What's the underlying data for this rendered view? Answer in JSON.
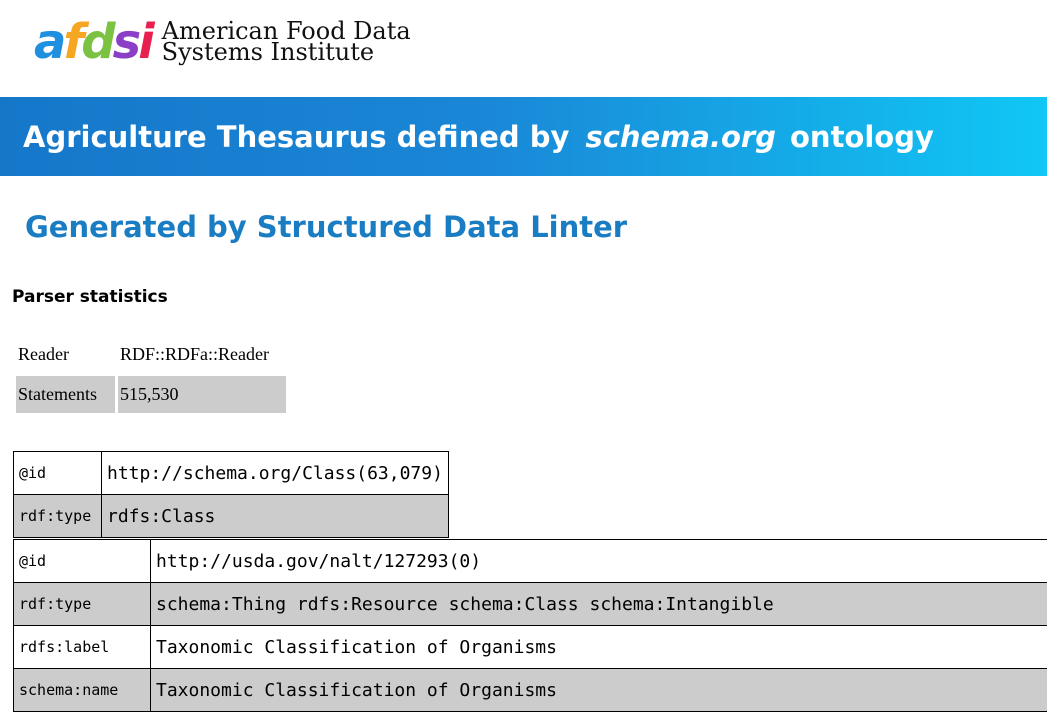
{
  "logo": {
    "letters": [
      {
        "ch": "a",
        "color": "#1f8fe0"
      },
      {
        "ch": "f",
        "color": "#f5a623"
      },
      {
        "ch": "d",
        "color": "#7cc242"
      },
      {
        "ch": "s",
        "color": "#8b3fc7"
      },
      {
        "ch": "i",
        "color": "#e8204f"
      }
    ],
    "line1": "American Food Data",
    "line2": "Systems Institute"
  },
  "banner": {
    "prefix": "Agriculture Thesaurus defined by",
    "emphasis": "schema.org",
    "suffix": "ontology"
  },
  "subtitle": "Generated by Structured Data Linter",
  "parser": {
    "heading": "Parser statistics",
    "rows": [
      {
        "key": "Reader",
        "value": "RDF::RDFa::Reader"
      },
      {
        "key": "Statements",
        "value": "515,530"
      }
    ]
  },
  "entity1": {
    "rows": [
      {
        "key": "@id",
        "value": "http://schema.org/Class(63,079)"
      },
      {
        "key": "rdf:type",
        "value": "rdfs:Class"
      }
    ]
  },
  "entity2": {
    "rows": [
      {
        "key": "@id",
        "value": "http://usda.gov/nalt/127293(0)"
      },
      {
        "key": "rdf:type",
        "value": "schema:Thing rdfs:Resource schema:Class schema:Intangible"
      },
      {
        "key": "rdfs:label",
        "value": "Taxonomic Classification of Organisms"
      },
      {
        "key": "schema:name",
        "value": "Taxonomic Classification of Organisms"
      }
    ]
  }
}
